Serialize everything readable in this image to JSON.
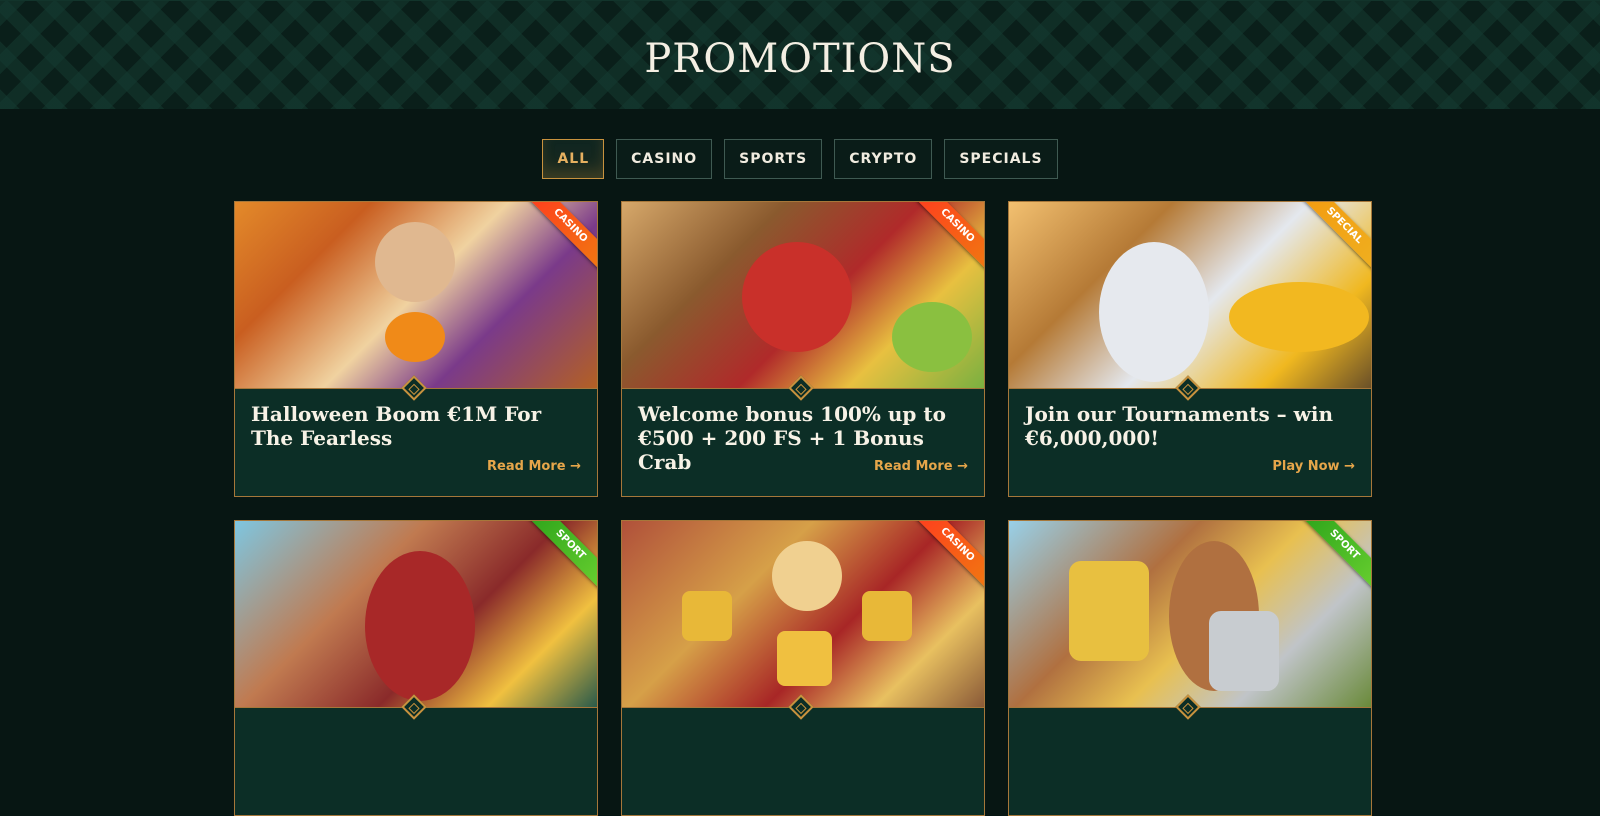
{
  "page": {
    "title": "PROMOTIONS"
  },
  "filters": [
    {
      "label": "ALL",
      "active": true
    },
    {
      "label": "CASINO",
      "active": false
    },
    {
      "label": "SPORTS",
      "active": false
    },
    {
      "label": "CRYPTO",
      "active": false
    },
    {
      "label": "SPECIALS",
      "active": false
    }
  ],
  "cards": [
    {
      "title": "Halloween Boom €1M For The Fearless",
      "link": "Read More →",
      "ribbon": "CASINO"
    },
    {
      "title": "Welcome bonus 100% up to €500 + 200 FS + 1 Bonus Crab",
      "link": "Read More →",
      "ribbon": "CASINO"
    },
    {
      "title": "Join our Tournaments – win €6,000,000!",
      "link": "Play Now →",
      "ribbon": "SPECIAL"
    },
    {
      "title": "",
      "link": "",
      "ribbon": "SPORT"
    },
    {
      "title": "",
      "link": "",
      "ribbon": "CASINO"
    },
    {
      "title": "",
      "link": "",
      "ribbon": "SPORT"
    }
  ]
}
